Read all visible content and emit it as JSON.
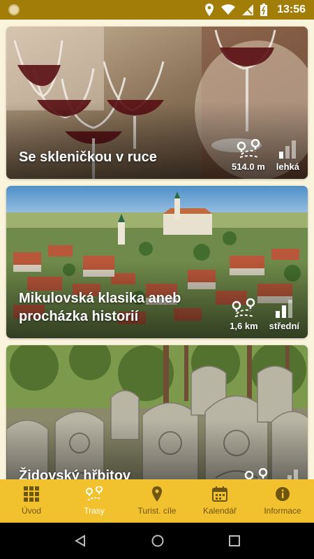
{
  "status_bar": {
    "time": "13:56"
  },
  "routes": [
    {
      "title": "Se skleničkou v ruce",
      "distance": "514.0 m",
      "difficulty": "lehká"
    },
    {
      "title": "Mikulovská klasika aneb procházka historií",
      "distance": "1,6 km",
      "difficulty": "střední"
    },
    {
      "title": "Židovský hřbitov",
      "distance": "",
      "difficulty": ""
    }
  ],
  "bottom_nav": [
    {
      "label": "Úvod",
      "icon": "grid-icon",
      "active": false
    },
    {
      "label": "Trasy",
      "icon": "route-icon",
      "active": true
    },
    {
      "label": "Turist. cíle",
      "icon": "location-pin-icon",
      "active": false
    },
    {
      "label": "Kalendář",
      "icon": "calendar-icon",
      "active": false
    },
    {
      "label": "Informace",
      "icon": "info-icon",
      "active": false
    }
  ],
  "colors": {
    "status_bar": "#a27d08",
    "nav_bar": "#f2c12e",
    "background": "#fbf4dc"
  }
}
